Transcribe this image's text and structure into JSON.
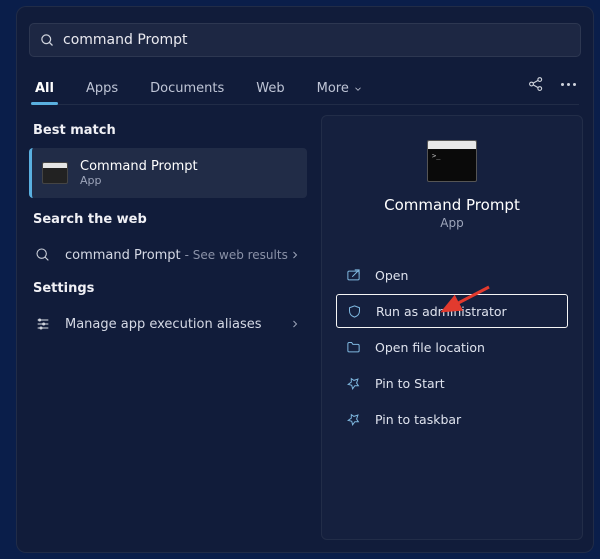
{
  "search": {
    "query": "command Prompt"
  },
  "tabs": [
    "All",
    "Apps",
    "Documents",
    "Web",
    "More"
  ],
  "sections": {
    "best": "Best match",
    "web": "Search the web",
    "settings": "Settings"
  },
  "best_match": {
    "title": "Command Prompt",
    "subtitle": "App"
  },
  "web_result": {
    "label": "command Prompt",
    "hint": "- See web results"
  },
  "settings_result": {
    "label": "Manage app execution aliases"
  },
  "detail": {
    "title": "Command Prompt",
    "subtitle": "App",
    "actions": [
      "Open",
      "Run as administrator",
      "Open file location",
      "Pin to Start",
      "Pin to taskbar"
    ],
    "selected_index": 1
  }
}
